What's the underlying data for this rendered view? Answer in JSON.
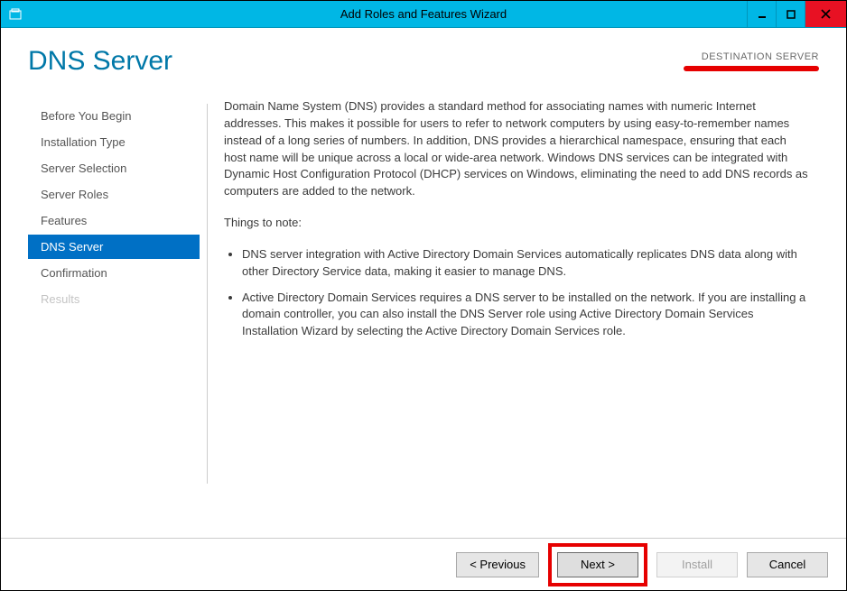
{
  "window": {
    "title": "Add Roles and Features Wizard"
  },
  "header": {
    "page_title": "DNS Server",
    "destination_label": "DESTINATION SERVER"
  },
  "sidebar": {
    "items": [
      {
        "label": "Before You Begin",
        "state": "normal"
      },
      {
        "label": "Installation Type",
        "state": "normal"
      },
      {
        "label": "Server Selection",
        "state": "normal"
      },
      {
        "label": "Server Roles",
        "state": "normal"
      },
      {
        "label": "Features",
        "state": "normal"
      },
      {
        "label": "DNS Server",
        "state": "active"
      },
      {
        "label": "Confirmation",
        "state": "normal"
      },
      {
        "label": "Results",
        "state": "disabled"
      }
    ]
  },
  "main": {
    "paragraph1": "Domain Name System (DNS) provides a standard method for associating names with numeric Internet addresses. This makes it possible for users to refer to network computers by using easy-to-remember names instead of a long series of numbers. In addition, DNS provides a hierarchical namespace, ensuring that each host name will be unique across a local or wide-area network. Windows DNS services can be integrated with Dynamic Host Configuration Protocol (DHCP) services on Windows, eliminating the need to add DNS records as computers are added to the network.",
    "subhead": "Things to note:",
    "bullets": [
      "DNS server integration with Active Directory Domain Services automatically replicates DNS data along with other Directory Service data, making it easier to manage DNS.",
      "Active Directory Domain Services requires a DNS server to be installed on the network. If you are installing a domain controller, you can also install the DNS Server role using Active Directory Domain Services Installation Wizard by selecting the Active Directory Domain Services role."
    ]
  },
  "footer": {
    "previous": "< Previous",
    "next": "Next >",
    "install": "Install",
    "cancel": "Cancel"
  }
}
